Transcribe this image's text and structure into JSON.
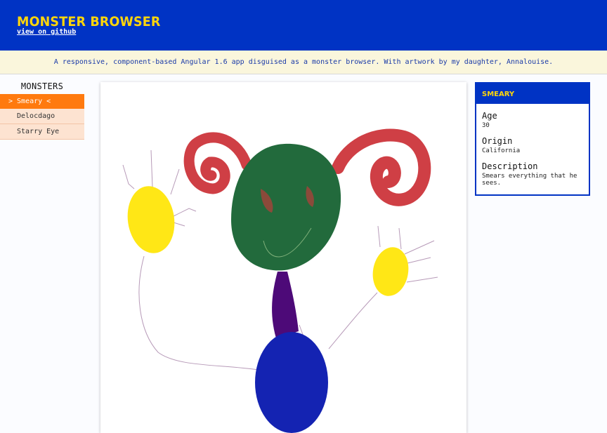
{
  "header": {
    "title": "MONSTER BROWSER",
    "github_link": "view on github"
  },
  "banner": {
    "text": "A responsive, component-based Angular 1.6 app disguised as a monster browser. With artwork by my daughter, Annalouise."
  },
  "sidebar": {
    "heading": "MONSTERS",
    "items": [
      {
        "label": "> Smeary <",
        "active": true
      },
      {
        "label": "Delocdago",
        "active": false
      },
      {
        "label": "Starry Eye",
        "active": false
      }
    ]
  },
  "details": {
    "name": "SMEARY",
    "fields": [
      {
        "label": "Age",
        "value": "30"
      },
      {
        "label": "Origin",
        "value": "California"
      },
      {
        "label": "Description",
        "value": "Smears everything that he sees."
      }
    ]
  },
  "colors": {
    "header_bg": "#0033c4",
    "accent_yellow": "#ffd60a",
    "active_orange": "#ff7a0f",
    "banner_bg": "#faf6dc"
  }
}
